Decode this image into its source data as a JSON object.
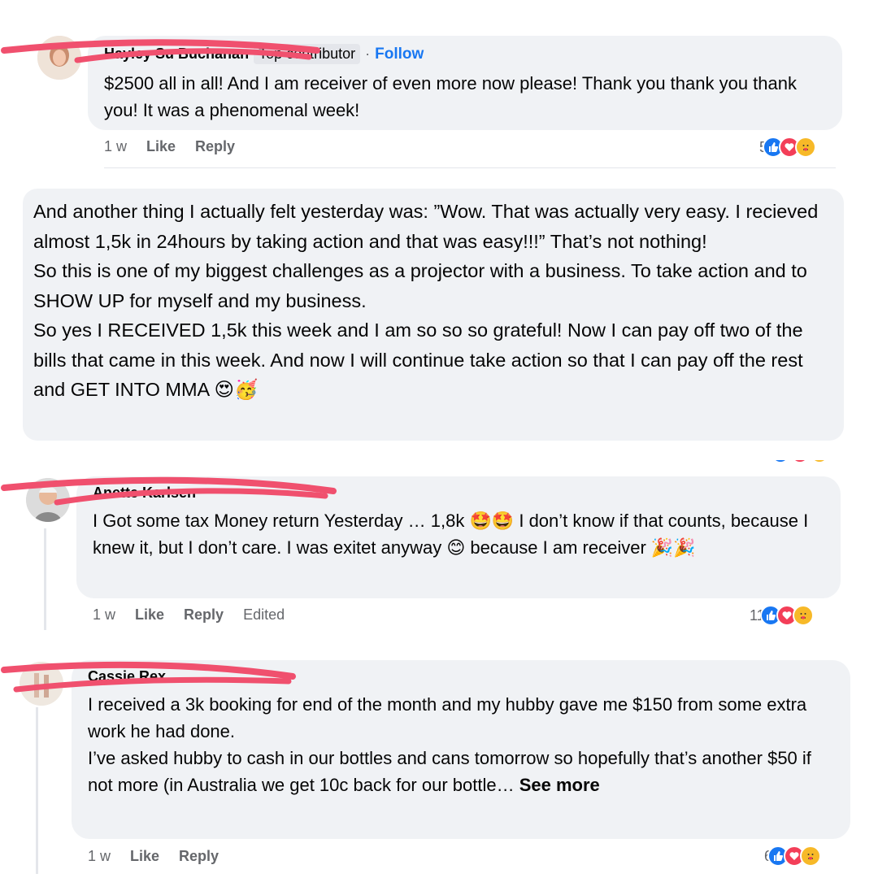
{
  "comments": [
    {
      "author": "Hayley Su Buchanan",
      "badge": "Top contributor",
      "separator": "·",
      "follow": "Follow",
      "text": "$2500 all in all! And I am receiver of even more now please! Thank you thank you thank you! It was a phenomenal week!",
      "time": "1 w",
      "like": "Like",
      "reply": "Reply",
      "reaction_count": "5"
    },
    {
      "text": "And another thing I actually felt yesterday was: ”Wow. That was actually very easy. I recieved almost 1,5k in 24hours by taking action and that was easy!!!” That’s not nothing!\nSo this is one of my biggest challenges as a projector with a business. To take action and to SHOW UP for myself and my business.\nSo yes I RECEIVED 1,5k this week and I am so so so grateful! Now I can pay off two of the bills that came in this week. And now I will continue take action so that I can pay off the rest and GET INTO MMA 😍🥳"
    },
    {
      "author": "Anette Karlsen",
      "text": "I Got some tax Money return Yesterday … 1,8k 🤩🤩 I don’t know if that counts, because I knew it, but I don’t care. I was exitet anyway 😊 because I am receiver 🎉🎉",
      "time": "1 w",
      "like": "Like",
      "reply": "Reply",
      "edited": "Edited",
      "reaction_count": "11"
    },
    {
      "author": "Cassie Rex",
      "text": "I received a 3k booking for end of the month and my hubby gave me $150 from some extra work he had done.\nI’ve asked hubby to cash in our bottles and cans tomorrow so hopefully that’s another $50 if not more (in Australia we get 10c back for our bottle… ",
      "see_more": "See more",
      "time": "1 w",
      "like": "Like",
      "reply": "Reply",
      "reaction_count": "6"
    }
  ],
  "colors": {
    "bubble": "#f0f2f5",
    "like_blue": "#1877f2",
    "love_red": "#f33e58",
    "care_yellow": "#f7b928",
    "scribble": "#f0506e"
  },
  "icons": [
    "like-reaction-icon",
    "love-reaction-icon",
    "care-reaction-icon"
  ]
}
